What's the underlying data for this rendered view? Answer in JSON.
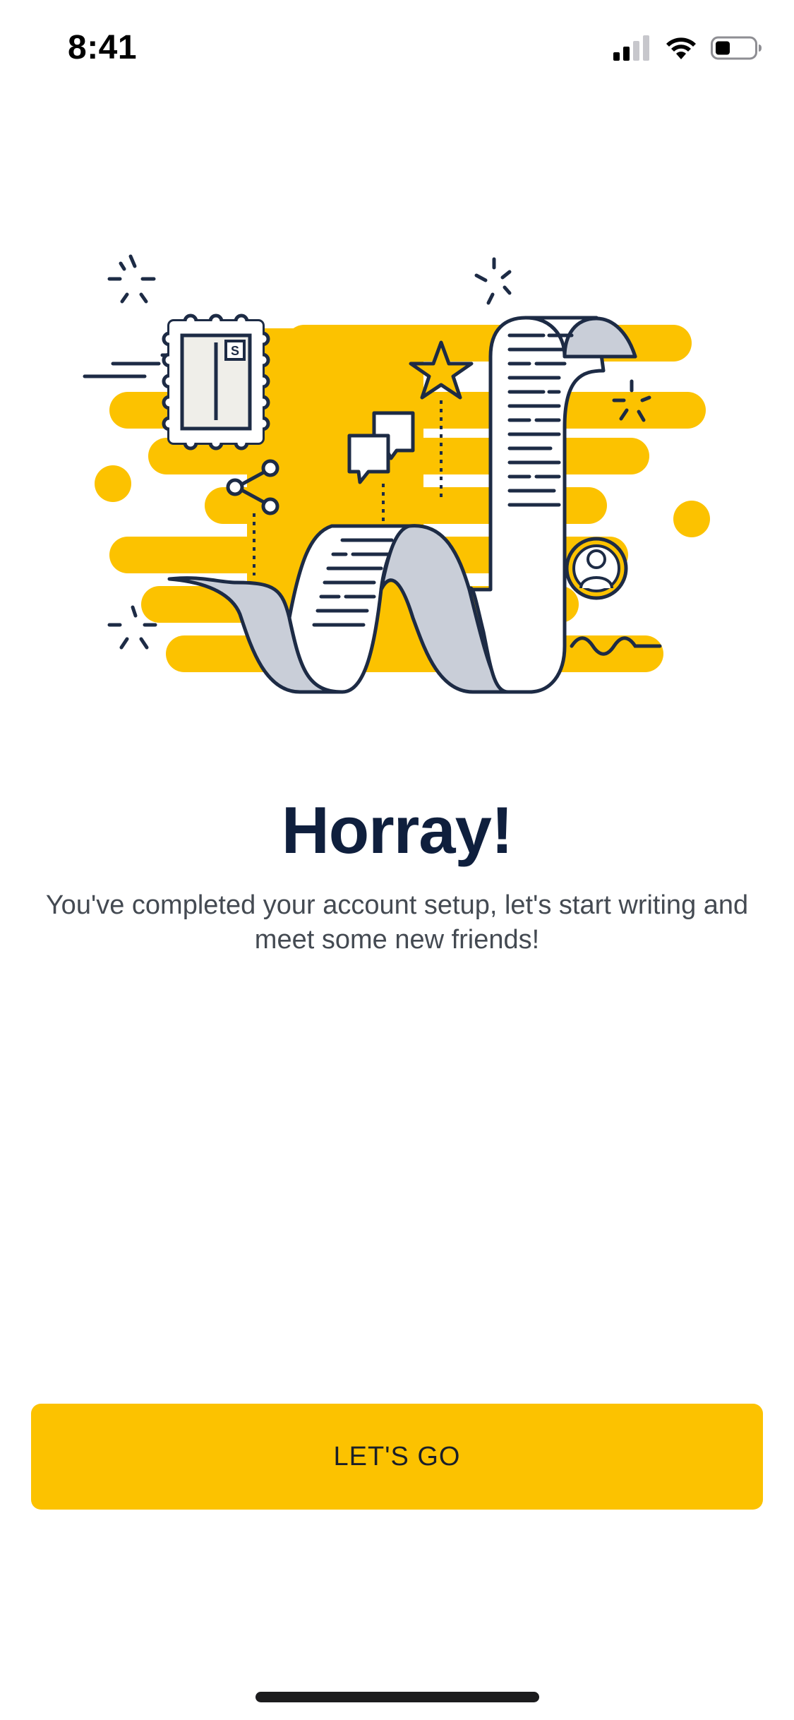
{
  "status_bar": {
    "time": "8:41",
    "icons": [
      "cellular-signal-icon",
      "wifi-icon",
      "battery-icon"
    ]
  },
  "illustration": {
    "name": "writing-scroll-illustration",
    "stamp_mark": "S"
  },
  "content": {
    "title": "Horray!",
    "subtitle": "You've completed your account setup, let's start writing and meet some new friends!"
  },
  "actions": {
    "primary_label": "LET'S GO"
  },
  "colors": {
    "accent": "#fcc200",
    "navy": "#0f1f3d",
    "paper_shade": "#c9ced8",
    "text_body": "#444a52"
  }
}
